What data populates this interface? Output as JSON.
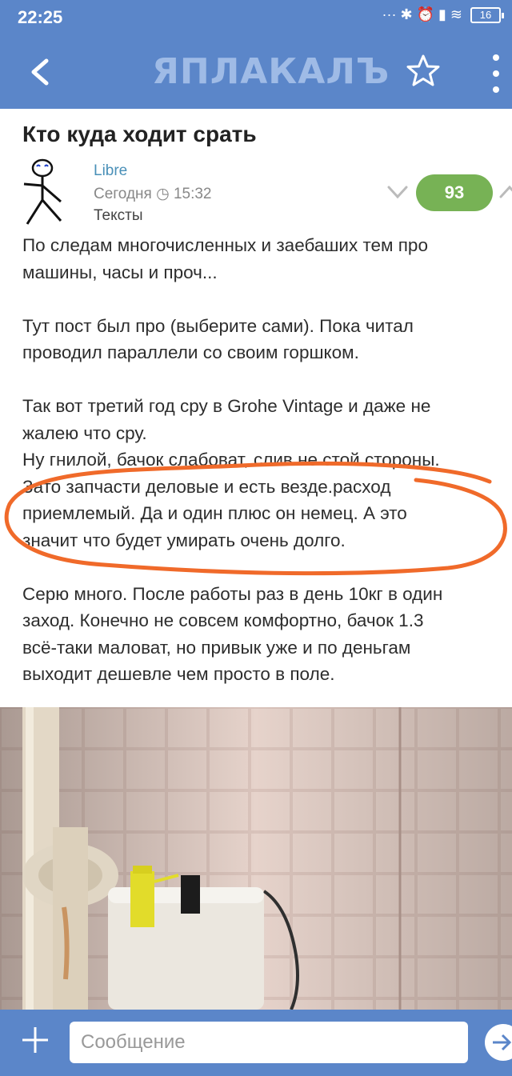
{
  "status_bar": {
    "time": "22:25",
    "icons_text": "··· ✱ ⏰ ▮ ≋",
    "battery": "16"
  },
  "app_bar": {
    "logo": "ЯПЛАКАЛЪ",
    "back_icon": "chevron-left-icon",
    "favorite_icon": "star-icon",
    "menu_icon": "more-vertical-icon"
  },
  "post": {
    "title": "Кто куда ходит срать",
    "author": "Libre",
    "date": "Сегодня ◷ 15:32",
    "category": "Тексты",
    "rating": "93",
    "paragraphs": [
      "По следам многочисленных и заебаших тем про\nмашины, часы и проч...",
      "Тут пост был про (выберите сами). Пока читал\nпроводил параллели со своим горшком.",
      "Так вот третий год сру в Grohe Vintage и даже не\nжалею что сру.\nНу гнилой, бачок слабоват, слив не стой стороны.\nЗато запчасти деловые и есть везде.расход\nприемлемый. Да и один плюс он немец. А это\nзначит что будет умирать очень долго.",
      "Серю много. После работы раз в день 10кг в один\nзаход. Конечно не совсем комфортно, бачок 1.3\nвсё-таки маловат, но привык уже и по деньгам\nвыходит дешевле чем просто в поле."
    ]
  },
  "composer": {
    "placeholder": "Сообщение",
    "attach_icon": "plus-icon",
    "send_icon": "send-arrow-icon"
  },
  "colors": {
    "primary": "#5b86c9",
    "rating_badge": "#77b255",
    "annotation": "#f06a2a",
    "author_link": "#4a90b8"
  }
}
